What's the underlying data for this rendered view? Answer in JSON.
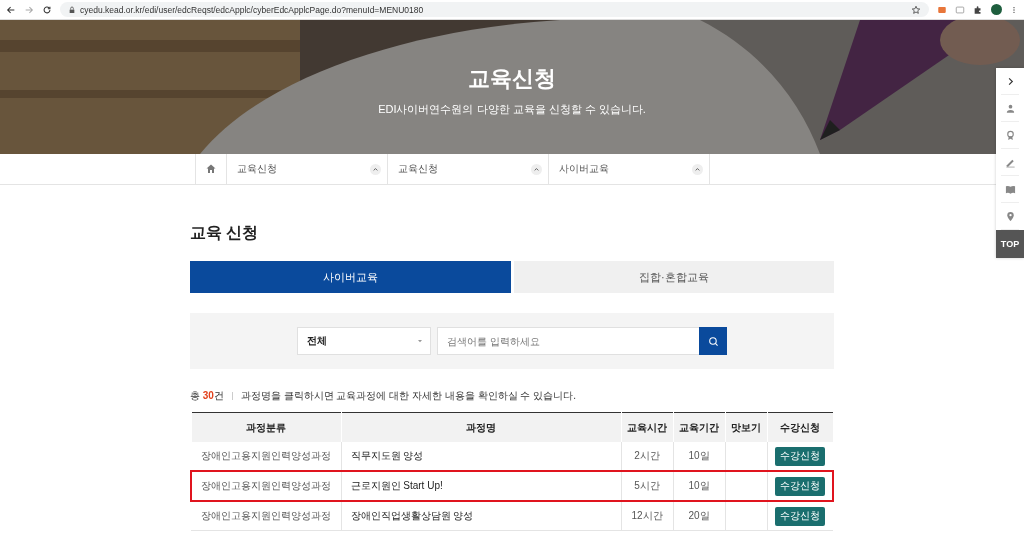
{
  "browser": {
    "url": "cyedu.kead.or.kr/edi/user/edcReqst/edcApplc/cyberEdcApplcPage.do?menuId=MENU0180"
  },
  "hero": {
    "title": "교육신청",
    "subtitle": "EDI사이버연수원의 다양한 교육을 신청할 수 있습니다."
  },
  "breadcrumb": [
    "교육신청",
    "교육신청",
    "사이버교육"
  ],
  "page_title": "교육 신청",
  "tabs": [
    {
      "label": "사이버교육",
      "selected": true
    },
    {
      "label": "집합·혼합교육",
      "selected": false
    }
  ],
  "search": {
    "category": "전체",
    "placeholder": "검색어를 입력하세요"
  },
  "summary": {
    "prefix": "총",
    "count": "30",
    "unit": "건",
    "note": "과정명을 클릭하시면 교육과정에 대한 자세한 내용을 확인하실 수 있습니다."
  },
  "table": {
    "columns": [
      "과정분류",
      "과정명",
      "교육시간",
      "교육기간",
      "맛보기",
      "수강신청"
    ],
    "rows": [
      {
        "category": "장애인고용지원인력양성과정",
        "name": "직무지도원 양성",
        "hours": "2시간",
        "period": "10일",
        "action": "수강신청",
        "highlighted": false
      },
      {
        "category": "장애인고용지원인력양성과정",
        "name": "근로지원인 Start Up!",
        "hours": "5시간",
        "period": "10일",
        "action": "수강신청",
        "highlighted": true
      },
      {
        "category": "장애인고용지원인력양성과정",
        "name": "장애인직업생활상담원 양성",
        "hours": "12시간",
        "period": "20일",
        "action": "수강신청",
        "highlighted": false
      }
    ]
  },
  "quick_menu": {
    "top_label": "TOP"
  }
}
